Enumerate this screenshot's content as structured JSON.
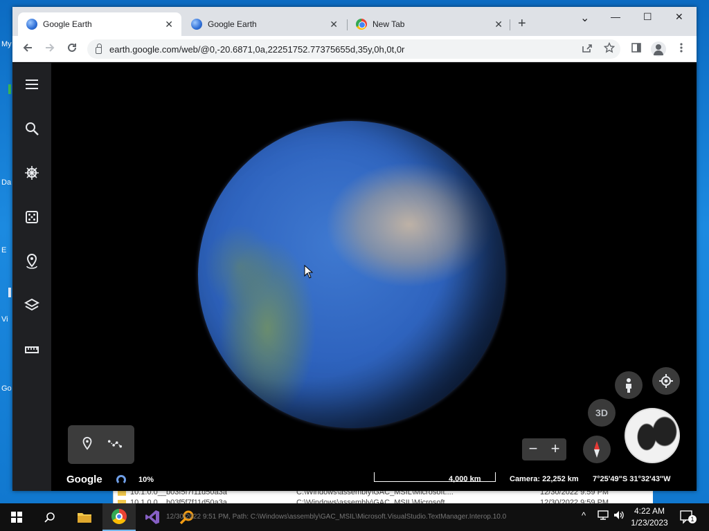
{
  "desktop": {
    "labels": [
      "My",
      "Da",
      "E",
      "Vi",
      "Go"
    ]
  },
  "background_window": {
    "rows": [
      {
        "name": "10.1.0.0__b03f5f7f11d50a3a",
        "path": "C:\\Windows\\assembly\\GAC_MSIL\\Microsoft....",
        "date": "12/30/2022 9:59 PM"
      },
      {
        "name": "10.1.0.0__b03f5f7f11d50a3a",
        "path": "C:\\Windows\\assembly\\GAC_MSIL\\Microsoft....",
        "date": "12/30/2022 9:59 PM"
      }
    ]
  },
  "browser": {
    "tabs": [
      {
        "title": "Google Earth",
        "icon": "earth-favicon",
        "active": true
      },
      {
        "title": "Google Earth",
        "icon": "earth-favicon",
        "active": false
      },
      {
        "title": "New Tab",
        "icon": "chrome-favicon",
        "active": false
      }
    ],
    "new_tab": "+",
    "window_controls": {
      "dropdown": "⌄",
      "minimize": "—",
      "maximize": "☐",
      "close": "✕"
    },
    "url": "earth.google.com/web/@0,-20.6871,0a,22251752.77375655d,35y,0h,0t,0r"
  },
  "earth": {
    "three_d_label": "3D",
    "zoom_out": "−",
    "zoom_in": "+",
    "google_logo": "Google",
    "loading_percent": "10%",
    "scale_label": "4,000 km",
    "camera": "Camera: 22,252 km",
    "coordinates": "7°25'49\"S 31°32'43\"W"
  },
  "taskbar": {
    "status_text": "12/30/2022 9:51 PM, Path: C:\\Windows\\assembly\\GAC_MSIL\\Microsoft.VisualStudio.TextManager.Interop.10.0",
    "clock_time": "4:22 AM",
    "clock_date": "1/23/2023",
    "notification_count": "1"
  },
  "colors": {
    "accent": "#1a73e8",
    "taskbar": "#101010",
    "sidebar": "#1f2023"
  }
}
